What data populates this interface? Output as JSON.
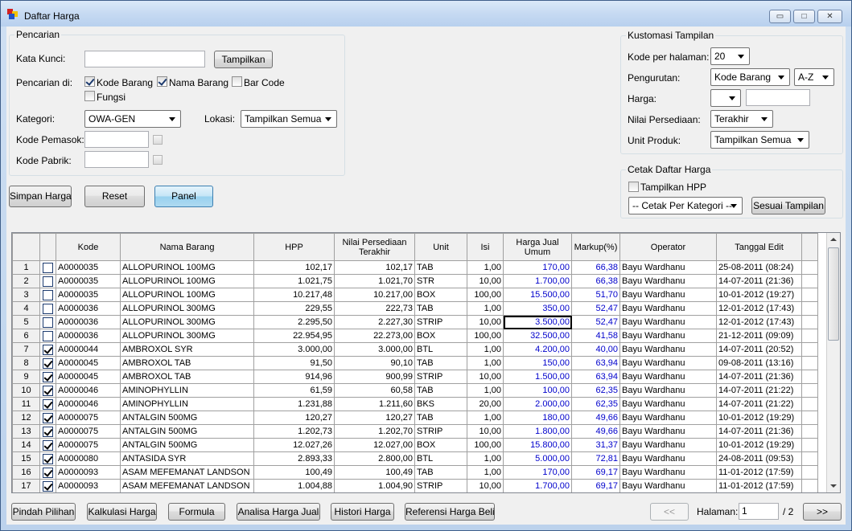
{
  "window": {
    "title": "Daftar Harga",
    "min_label": "▭",
    "max_label": "□",
    "close_label": "✕"
  },
  "search": {
    "legend": "Pencarian",
    "keyword_label": "Kata Kunci:",
    "keyword_value": "",
    "show_button": "Tampilkan",
    "search_in_label": "Pencarian di:",
    "cb_kode": "Kode Barang",
    "cb_nama": "Nama Barang",
    "cb_barcode": "Bar Code",
    "cb_fungsi": "Fungsi",
    "category_label": "Kategori:",
    "category_value": "OWA-GEN",
    "location_label": "Lokasi:",
    "location_value": "Tampilkan Semua",
    "supplier_label": "Kode Pemasok:",
    "factory_label": "Kode Pabrik:"
  },
  "actions": {
    "save": "Simpan Harga",
    "reset": "Reset",
    "panel": "Panel"
  },
  "custom": {
    "legend": "Kustomasi Tampilan",
    "per_page_label": "Kode per halaman:",
    "per_page_value": "20",
    "sort_label": "Pengurutan:",
    "sort_value": "Kode Barang",
    "sort_dir": "A-Z",
    "price_label": "Harga:",
    "price_op": "",
    "stock_label": "Nilai Persediaan:",
    "stock_value": "Terakhir",
    "unit_label": "Unit Produk:",
    "unit_value": "Tampilkan Semua"
  },
  "print": {
    "legend": "Cetak Daftar Harga",
    "show_hpp": "Tampilkan HPP",
    "per_category": "-- Cetak Per Kategori --",
    "as_displayed": "Sesuai Tampilan"
  },
  "columns": [
    "",
    "",
    "Kode",
    "Nama Barang",
    "HPP",
    "Nilai Persediaan Terakhir",
    "Unit",
    "Isi",
    "Harga Jual Umum",
    "Markup(%)",
    "Operator",
    "Tanggal Edit"
  ],
  "rows": [
    {
      "n": "1",
      "chk": false,
      "kode": "A0000035",
      "nama": "ALLOPURINOL 100MG",
      "hpp": "102,17",
      "nilai": "102,17",
      "unit": "TAB",
      "isi": "1,00",
      "harga": "170,00",
      "markup": "66,38",
      "op": "Bayu Wardhanu",
      "tgl": "25-08-2011 (08:24)"
    },
    {
      "n": "2",
      "chk": false,
      "kode": "A0000035",
      "nama": "ALLOPURINOL 100MG",
      "hpp": "1.021,75",
      "nilai": "1.021,70",
      "unit": "STR",
      "isi": "10,00",
      "harga": "1.700,00",
      "markup": "66,38",
      "op": "Bayu Wardhanu",
      "tgl": "14-07-2011 (21:36)"
    },
    {
      "n": "3",
      "chk": false,
      "kode": "A0000035",
      "nama": "ALLOPURINOL 100MG",
      "hpp": "10.217,48",
      "nilai": "10.217,00",
      "unit": "BOX",
      "isi": "100,00",
      "harga": "15.500,00",
      "markup": "51,70",
      "op": "Bayu Wardhanu",
      "tgl": "10-01-2012 (19:27)"
    },
    {
      "n": "4",
      "chk": false,
      "kode": "A0000036",
      "nama": "ALLOPURINOL 300MG",
      "hpp": "229,55",
      "nilai": "222,73",
      "unit": "TAB",
      "isi": "1,00",
      "harga": "350,00",
      "markup": "52,47",
      "op": "Bayu Wardhanu",
      "tgl": "12-01-2012 (17:43)"
    },
    {
      "n": "5",
      "chk": false,
      "kode": "A0000036",
      "nama": "ALLOPURINOL 300MG",
      "hpp": "2.295,50",
      "nilai": "2.227,30",
      "unit": "STRIP",
      "isi": "10,00",
      "harga": "3.500,00",
      "markup": "52,47",
      "op": "Bayu Wardhanu",
      "tgl": "12-01-2012 (17:43)",
      "focus": true
    },
    {
      "n": "6",
      "chk": false,
      "kode": "A0000036",
      "nama": "ALLOPURINOL 300MG",
      "hpp": "22.954,95",
      "nilai": "22.273,00",
      "unit": "BOX",
      "isi": "100,00",
      "harga": "32.500,00",
      "markup": "41,58",
      "op": "Bayu Wardhanu",
      "tgl": "21-12-2011 (09:09)"
    },
    {
      "n": "7",
      "chk": true,
      "kode": "A0000044",
      "nama": "AMBROXOL SYR",
      "hpp": "3.000,00",
      "nilai": "3.000,00",
      "unit": "BTL",
      "isi": "1,00",
      "harga": "4.200,00",
      "markup": "40,00",
      "op": "Bayu Wardhanu",
      "tgl": "14-07-2011 (20:52)"
    },
    {
      "n": "8",
      "chk": true,
      "kode": "A0000045",
      "nama": "AMBROXOL TAB",
      "hpp": "91,50",
      "nilai": "90,10",
      "unit": "TAB",
      "isi": "1,00",
      "harga": "150,00",
      "markup": "63,94",
      "op": "Bayu Wardhanu",
      "tgl": "09-08-2011 (13:16)"
    },
    {
      "n": "9",
      "chk": true,
      "kode": "A0000045",
      "nama": "AMBROXOL TAB",
      "hpp": "914,96",
      "nilai": "900,99",
      "unit": "STRIP",
      "isi": "10,00",
      "harga": "1.500,00",
      "markup": "63,94",
      "op": "Bayu Wardhanu",
      "tgl": "14-07-2011 (21:36)"
    },
    {
      "n": "10",
      "chk": true,
      "kode": "A0000046",
      "nama": "AMINOPHYLLIN",
      "hpp": "61,59",
      "nilai": "60,58",
      "unit": "TAB",
      "isi": "1,00",
      "harga": "100,00",
      "markup": "62,35",
      "op": "Bayu Wardhanu",
      "tgl": "14-07-2011 (21:22)"
    },
    {
      "n": "11",
      "chk": true,
      "kode": "A0000046",
      "nama": "AMINOPHYLLIN",
      "hpp": "1.231,88",
      "nilai": "1.211,60",
      "unit": "BKS",
      "isi": "20,00",
      "harga": "2.000,00",
      "markup": "62,35",
      "op": "Bayu Wardhanu",
      "tgl": "14-07-2011 (21:22)"
    },
    {
      "n": "12",
      "chk": true,
      "kode": "A0000075",
      "nama": "ANTALGIN 500MG",
      "hpp": "120,27",
      "nilai": "120,27",
      "unit": "TAB",
      "isi": "1,00",
      "harga": "180,00",
      "markup": "49,66",
      "op": "Bayu Wardhanu",
      "tgl": "10-01-2012 (19:29)"
    },
    {
      "n": "13",
      "chk": true,
      "kode": "A0000075",
      "nama": "ANTALGIN 500MG",
      "hpp": "1.202,73",
      "nilai": "1.202,70",
      "unit": "STRIP",
      "isi": "10,00",
      "harga": "1.800,00",
      "markup": "49,66",
      "op": "Bayu Wardhanu",
      "tgl": "14-07-2011 (21:36)"
    },
    {
      "n": "14",
      "chk": true,
      "kode": "A0000075",
      "nama": "ANTALGIN 500MG",
      "hpp": "12.027,26",
      "nilai": "12.027,00",
      "unit": "BOX",
      "isi": "100,00",
      "harga": "15.800,00",
      "markup": "31,37",
      "op": "Bayu Wardhanu",
      "tgl": "10-01-2012 (19:29)"
    },
    {
      "n": "15",
      "chk": true,
      "kode": "A0000080",
      "nama": "ANTASIDA SYR",
      "hpp": "2.893,33",
      "nilai": "2.800,00",
      "unit": "BTL",
      "isi": "1,00",
      "harga": "5.000,00",
      "markup": "72,81",
      "op": "Bayu Wardhanu",
      "tgl": "24-08-2011 (09:53)"
    },
    {
      "n": "16",
      "chk": true,
      "kode": "A0000093",
      "nama": "ASAM MEFEMANAT LANDSON",
      "hpp": "100,49",
      "nilai": "100,49",
      "unit": "TAB",
      "isi": "1,00",
      "harga": "170,00",
      "markup": "69,17",
      "op": "Bayu Wardhanu",
      "tgl": "11-01-2012 (17:59)"
    },
    {
      "n": "17",
      "chk": true,
      "kode": "A0000093",
      "nama": "ASAM MEFEMANAT LANDSON",
      "hpp": "1.004,88",
      "nilai": "1.004,90",
      "unit": "STRIP",
      "isi": "10,00",
      "harga": "1.700,00",
      "markup": "69,17",
      "op": "Bayu Wardhanu",
      "tgl": "11-01-2012 (17:59)"
    }
  ],
  "bottom": {
    "move": "Pindah Pilihan",
    "calc": "Kalkulasi Harga",
    "formula": "Formula",
    "analysis": "Analisa Harga Jual",
    "history": "Histori Harga",
    "reference": "Referensi Harga Beli",
    "prev": "<<",
    "page_label": "Halaman:",
    "page_value": "1",
    "page_total": "/ 2",
    "next": ">>"
  }
}
